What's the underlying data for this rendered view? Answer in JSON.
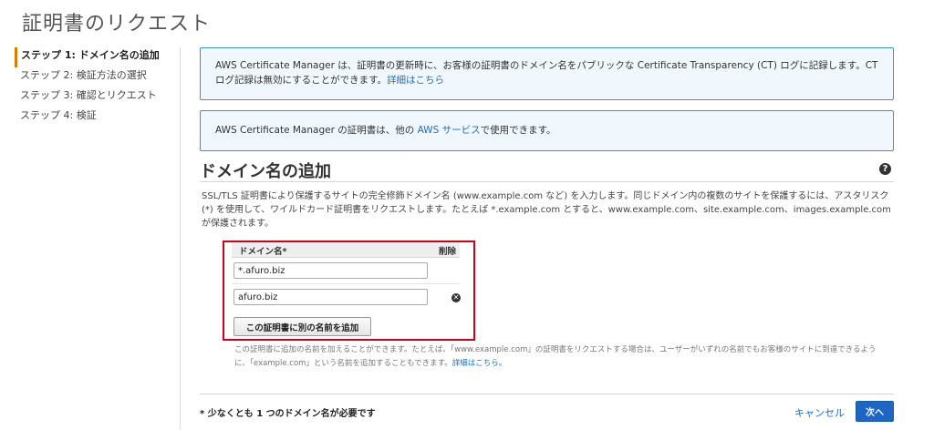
{
  "page": {
    "title": "証明書のリクエスト"
  },
  "steps": [
    {
      "label": "ステップ 1: ドメイン名の追加",
      "active": true
    },
    {
      "label": "ステップ 2: 検証方法の選択",
      "active": false
    },
    {
      "label": "ステップ 3: 確認とリクエスト",
      "active": false
    },
    {
      "label": "ステップ 4: 検証",
      "active": false
    }
  ],
  "info1": {
    "text": "AWS Certificate Manager は、証明書の更新時に、お客様の証明書のドメイン名をパブリックな Certificate Transparency (CT) ログに記録します。CT ログ記録は無効にすることができます。",
    "link": "詳細はこちら"
  },
  "info2": {
    "text_before": "AWS Certificate Manager の証明書は、他の ",
    "link": "AWS サービス",
    "text_after": "で使用できます。"
  },
  "section": {
    "title": "ドメイン名の追加",
    "help_icon": "question-circle-icon",
    "description": "SSL/TLS 証明書により保護するサイトの完全修飾ドメイン名 (www.example.com など) を入力します。同じドメイン内の複数のサイトを保護するには、アスタリスク (*) を使用して、ワイルドカード証明書をリクエストします。たとえば *.example.com とすると、www.example.com、site.example.com、images.example.com が保護されます。"
  },
  "domain_table": {
    "col_name": "ドメイン名*",
    "col_delete": "削除",
    "rows": [
      {
        "value": "*.afuro.biz",
        "deletable": false
      },
      {
        "value": "afuro.biz",
        "deletable": true
      }
    ],
    "delete_icon": "x-circle-icon",
    "add_button": "この証明書に別の名前を追加"
  },
  "hint": {
    "text": "この証明書に追加の名前を加えることができます。たとえば、「www.example.com」の証明書をリクエストする場合は、ユーザーがいずれの名前でもお客様のサイトに到達できるように、「example.com」という名前を追加することもできます。",
    "link": "詳細はこちら。"
  },
  "footer": {
    "required_note": "* 少なくとも 1 つのドメイン名が必要です",
    "cancel": "キャンセル",
    "next": "次へ"
  },
  "colors": {
    "accent_link": "#1e6fb9",
    "active_step_marker": "#e07b00",
    "info_border": "#3d8fc6",
    "info_background": "#f1f8fd",
    "primary_button": "#1e66c6",
    "highlight_frame": "#d0021b"
  }
}
